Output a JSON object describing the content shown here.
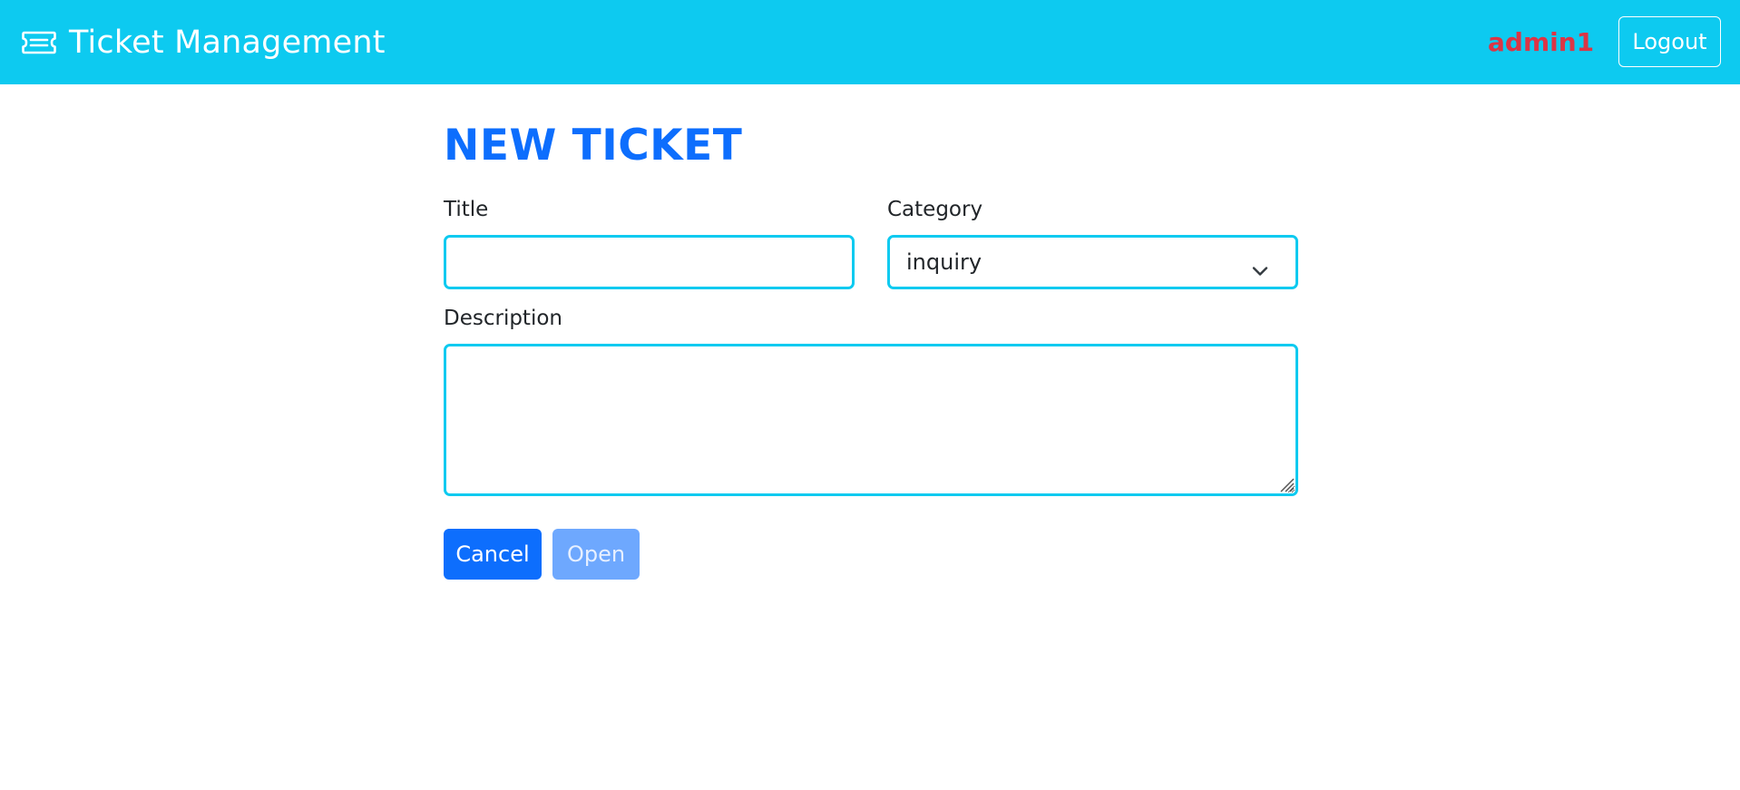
{
  "navbar": {
    "brand_icon": "ticket-icon",
    "brand_title": "Ticket Management",
    "username": "admin1",
    "logout_label": "Logout",
    "background_color": "#0dcaf0",
    "username_color": "#dc3545"
  },
  "form": {
    "heading": "NEW TICKET",
    "title_label": "Title",
    "title_value": "",
    "category_label": "Category",
    "category_selected": "inquiry",
    "category_icon": "chevron-down-icon",
    "description_label": "Description",
    "description_value": "",
    "cancel_label": "Cancel",
    "open_label": "Open",
    "open_disabled": true,
    "accent_color": "#0d6efd",
    "field_border_color": "#0dcaf0"
  }
}
